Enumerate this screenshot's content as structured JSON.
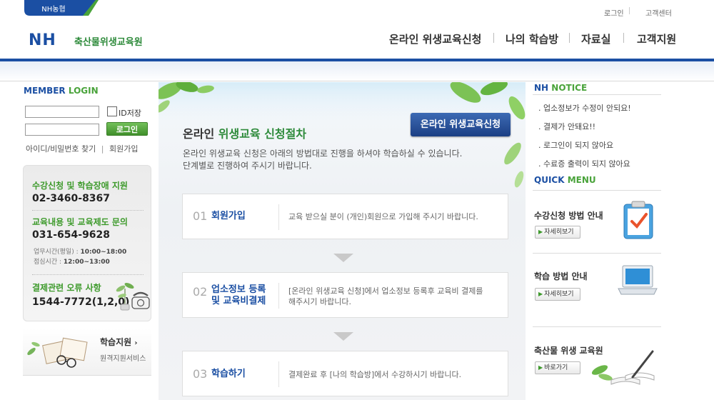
{
  "header": {
    "brand_tab": "NH농협",
    "logo_mark": "NH",
    "logo_name": "축산물위생교육원",
    "util_login": "로그인",
    "util_support": "고객센터",
    "nav": [
      "온라인 위생교육신청",
      "나의 학습방",
      "자료실",
      "고객지원"
    ]
  },
  "login": {
    "title_a": "MEMBER",
    "title_b": "LOGIN",
    "id_value": "",
    "pw_value": "",
    "save_id_label": "ID저장",
    "login_button": "로그인",
    "find_link": "아이디/비밀번호 찾기",
    "link_sep": "|",
    "join_link": "회원가입"
  },
  "support": {
    "s1_title": "수강신청 및 학습장애 지원",
    "s1_phone": "02-3460-8367",
    "s2_title": "교육내용 및 교육제도 문의",
    "s2_phone": "031-654-9628",
    "hours_label": "업무시간(평일) :",
    "hours_value": "10:00~18:00",
    "lunch_label": "점심시간 :",
    "lunch_value": "12:00~13:00",
    "err_title": "결제관련 오류 사항",
    "err_phone": "1544-7772(1,2,0)"
  },
  "study": {
    "title": "학습지원",
    "arrow": "›",
    "sub": "원격지원서비스"
  },
  "main": {
    "title_a": "온라인",
    "title_b": "위생교육 신청절차",
    "desc_1": "온라인 위생교육 신청은 아래의 방법대로 진행을 하셔야 학습하실 수 있습니다.",
    "desc_2": "단계별로 진행하여 주시기 바랍니다.",
    "apply_button": "온라인 위생교육신청",
    "steps": [
      {
        "num": "01",
        "name_1": "회원가입",
        "name_2": "",
        "desc_1": "교육 받으실 분이 (개인)회원으로 가입해 주시기  바랍니다.",
        "desc_2": ""
      },
      {
        "num": "02",
        "name_1": "업소정보 등록",
        "name_2": "및 교육비결제",
        "desc_1": "[온라인 위생교육 신청]에서 업소정보 등록후 교육비 결제를",
        "desc_2": "해주시기 바랍니다."
      },
      {
        "num": "03",
        "name_1": "학습하기",
        "name_2": "",
        "desc_1": "결제완료 후 [나의 학습방]에서 수강하시기 바랍니다.",
        "desc_2": ""
      }
    ]
  },
  "notice": {
    "title_a": "NH",
    "title_b": "NOTICE",
    "items": [
      ".  업소정보가 수정이 안되요!",
      ".  결제가 안돼요!!",
      ".  로그인이 되지 않아요",
      ".  수료증 출력이 되지 않아요"
    ]
  },
  "quick": {
    "title_a": "QUICK",
    "title_b": "MENU",
    "items": [
      {
        "label": "수강신청 방법 안내",
        "button": "자세히보기"
      },
      {
        "label": "학습 방법 안내",
        "button": "자세히보기"
      },
      {
        "label": "축산물 위생 교육원",
        "button": "바로가기"
      }
    ],
    "btn_arrow": "▶"
  },
  "colors": {
    "brand_blue": "#1b4fa3",
    "brand_green": "#49a33a"
  }
}
